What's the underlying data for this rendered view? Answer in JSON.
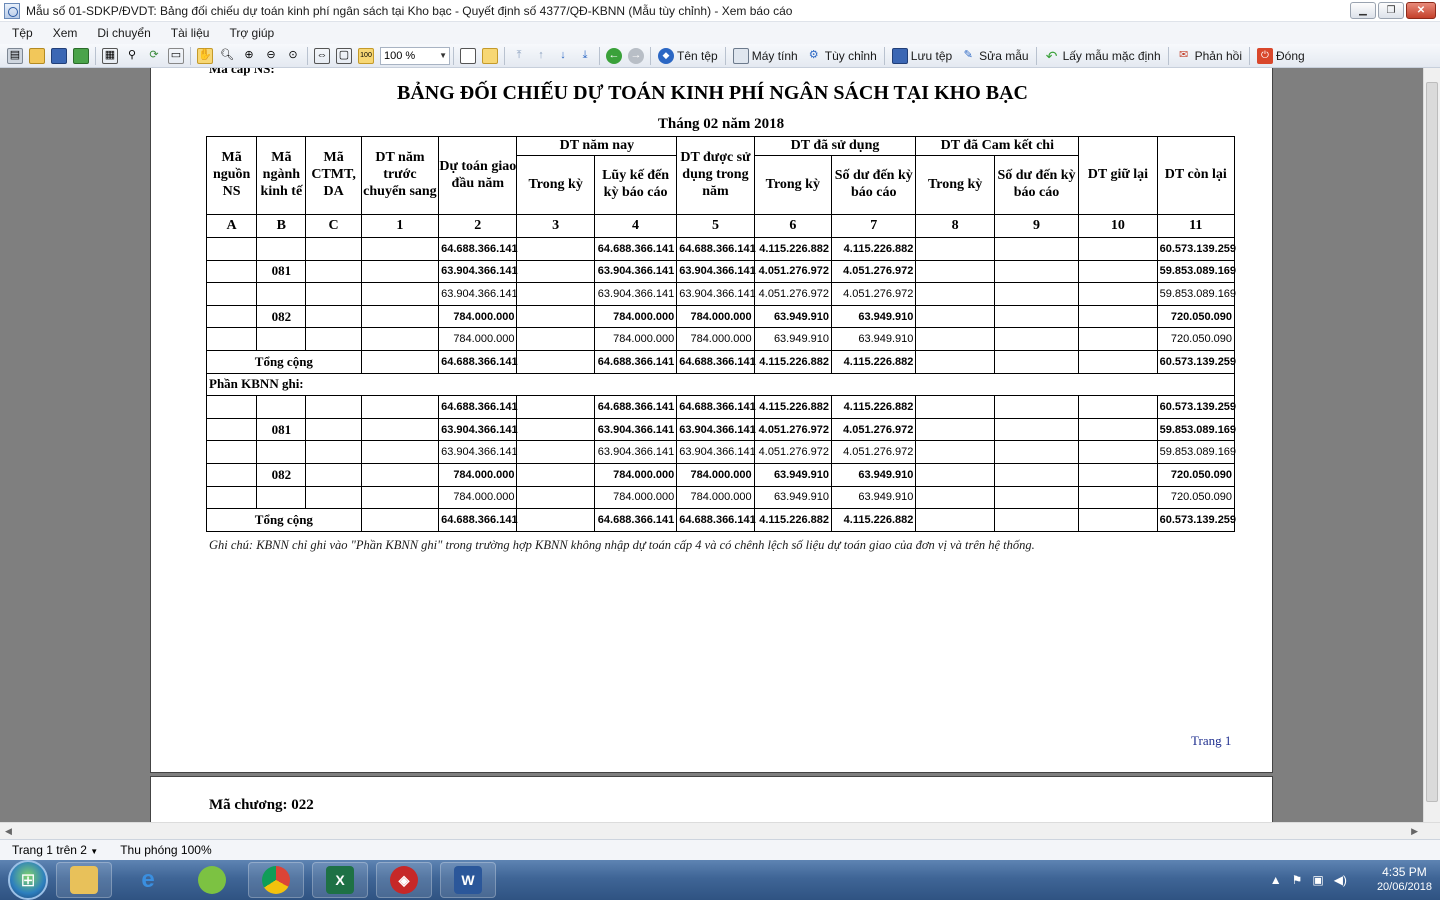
{
  "window": {
    "title": "Mẫu số 01-SDKP/ĐVDT: Bảng đối chiếu dự toán kinh phí ngân sách tại Kho bạc - Quyết định số 4377/QĐ-KBNN (Mẫu tùy chỉnh) - Xem báo cáo"
  },
  "menu": [
    "Tệp",
    "Xem",
    "Di chuyển",
    "Tài liệu",
    "Trợ giúp"
  ],
  "toolbar": {
    "zoom": "100 %",
    "buttons": {
      "ten_tep": "Tên tệp",
      "may_tinh": "Máy tính",
      "tuy_chinh": "Tùy chỉnh",
      "luu_tep": "Lưu tệp",
      "sua_mau": "Sửa mẫu",
      "lay_mau": "Lấy mẫu mặc định",
      "phan_hoi": "Phản hồi",
      "dong": "Đóng"
    }
  },
  "report": {
    "cut_header": "Mã cấp NS:",
    "title": "BẢNG ĐỐI CHIẾU DỰ TOÁN KINH PHÍ NGÂN SÁCH TẠI KHO BẠC",
    "period": "Tháng 02 năm 2018",
    "headers": {
      "ma_nguon": "Mã nguồn NS",
      "ma_nganh": "Mã ngành kinh tế",
      "ma_ctmt": "Mã CTMT, DA",
      "dt_nam_truoc": "DT năm trước chuyển sang",
      "du_toan_giao": "Dự toán giao đầu năm",
      "dt_nam_nay": "DT năm nay",
      "trong_ky": "Trong kỳ",
      "luy_ke": "Lũy kế đến kỳ báo cáo",
      "dt_duoc_sd": "DT được sử dụng trong năm",
      "dt_da_sd": "DT đã sử dụng",
      "trong_ky2": "Trong kỳ",
      "so_du": "Số dư đến kỳ báo cáo",
      "dt_cam_ket": "DT đã Cam kết chi",
      "trong_ky3": "Trong kỳ",
      "so_du2": "Số dư đến kỳ báo cáo",
      "dt_giu_lai": "DT giữ lại",
      "dt_con_lai": "DT còn lại"
    },
    "index_row": [
      "A",
      "B",
      "C",
      "1",
      "2",
      "3",
      "4",
      "5",
      "6",
      "7",
      "8",
      "9",
      "10",
      "11"
    ],
    "rows": {
      "r1": {
        "code": "",
        "c2": "64.688.366.141",
        "c4": "64.688.366.141",
        "c5": "64.688.366.141",
        "c6": "4.115.226.882",
        "c7": "4.115.226.882",
        "c11": "60.573.139.259"
      },
      "r2": {
        "code": "081",
        "c2": "63.904.366.141",
        "c4": "63.904.366.141",
        "c5": "63.904.366.141",
        "c6": "4.051.276.972",
        "c7": "4.051.276.972",
        "c11": "59.853.089.169"
      },
      "r3": {
        "code": "",
        "c2": "63.904.366.141",
        "c4": "63.904.366.141",
        "c5": "63.904.366.141",
        "c6": "4.051.276.972",
        "c7": "4.051.276.972",
        "c11": "59.853.089.169"
      },
      "r4": {
        "code": "082",
        "c2": "784.000.000",
        "c4": "784.000.000",
        "c5": "784.000.000",
        "c6": "63.949.910",
        "c7": "63.949.910",
        "c11": "720.050.090"
      },
      "r5": {
        "code": "",
        "c2": "784.000.000",
        "c4": "784.000.000",
        "c5": "784.000.000",
        "c6": "63.949.910",
        "c7": "63.949.910",
        "c11": "720.050.090"
      },
      "total": {
        "label": "Tổng cộng",
        "c2": "64.688.366.141",
        "c4": "64.688.366.141",
        "c5": "64.688.366.141",
        "c6": "4.115.226.882",
        "c7": "4.115.226.882",
        "c11": "60.573.139.259"
      },
      "section": "Phần KBNN ghi:",
      "k1": {
        "code": "",
        "c2": "64.688.366.141",
        "c4": "64.688.366.141",
        "c5": "64.688.366.141",
        "c6": "4.115.226.882",
        "c7": "4.115.226.882",
        "c11": "60.573.139.259"
      },
      "k2": {
        "code": "081",
        "c2": "63.904.366.141",
        "c4": "63.904.366.141",
        "c5": "63.904.366.141",
        "c6": "4.051.276.972",
        "c7": "4.051.276.972",
        "c11": "59.853.089.169"
      },
      "k3": {
        "code": "",
        "c2": "63.904.366.141",
        "c4": "63.904.366.141",
        "c5": "63.904.366.141",
        "c6": "4.051.276.972",
        "c7": "4.051.276.972",
        "c11": "59.853.089.169"
      },
      "k4": {
        "code": "082",
        "c2": "784.000.000",
        "c4": "784.000.000",
        "c5": "784.000.000",
        "c6": "63.949.910",
        "c7": "63.949.910",
        "c11": "720.050.090"
      },
      "k5": {
        "code": "",
        "c2": "784.000.000",
        "c4": "784.000.000",
        "c5": "784.000.000",
        "c6": "63.949.910",
        "c7": "63.949.910",
        "c11": "720.050.090"
      },
      "ktotal": {
        "label": "Tổng cộng",
        "c2": "64.688.366.141",
        "c4": "64.688.366.141",
        "c5": "64.688.366.141",
        "c6": "4.115.226.882",
        "c7": "4.115.226.882",
        "c11": "60.573.139.259"
      }
    },
    "note": "Ghi chú: KBNN chỉ ghi vào \"Phần KBNN ghi\" trong trường hợp KBNN không nhập dự toán cấp 4 và có chênh lệch số liệu dự toán giao của đơn vị và trên hệ thống.",
    "page_label": "Trang 1",
    "page2_header": "Mã chương: 022"
  },
  "status": {
    "page": "Trang 1 trên 2",
    "zoom": "Thu phóng 100%"
  },
  "tray": {
    "time": "4:35 PM",
    "date": "20/06/2018"
  }
}
